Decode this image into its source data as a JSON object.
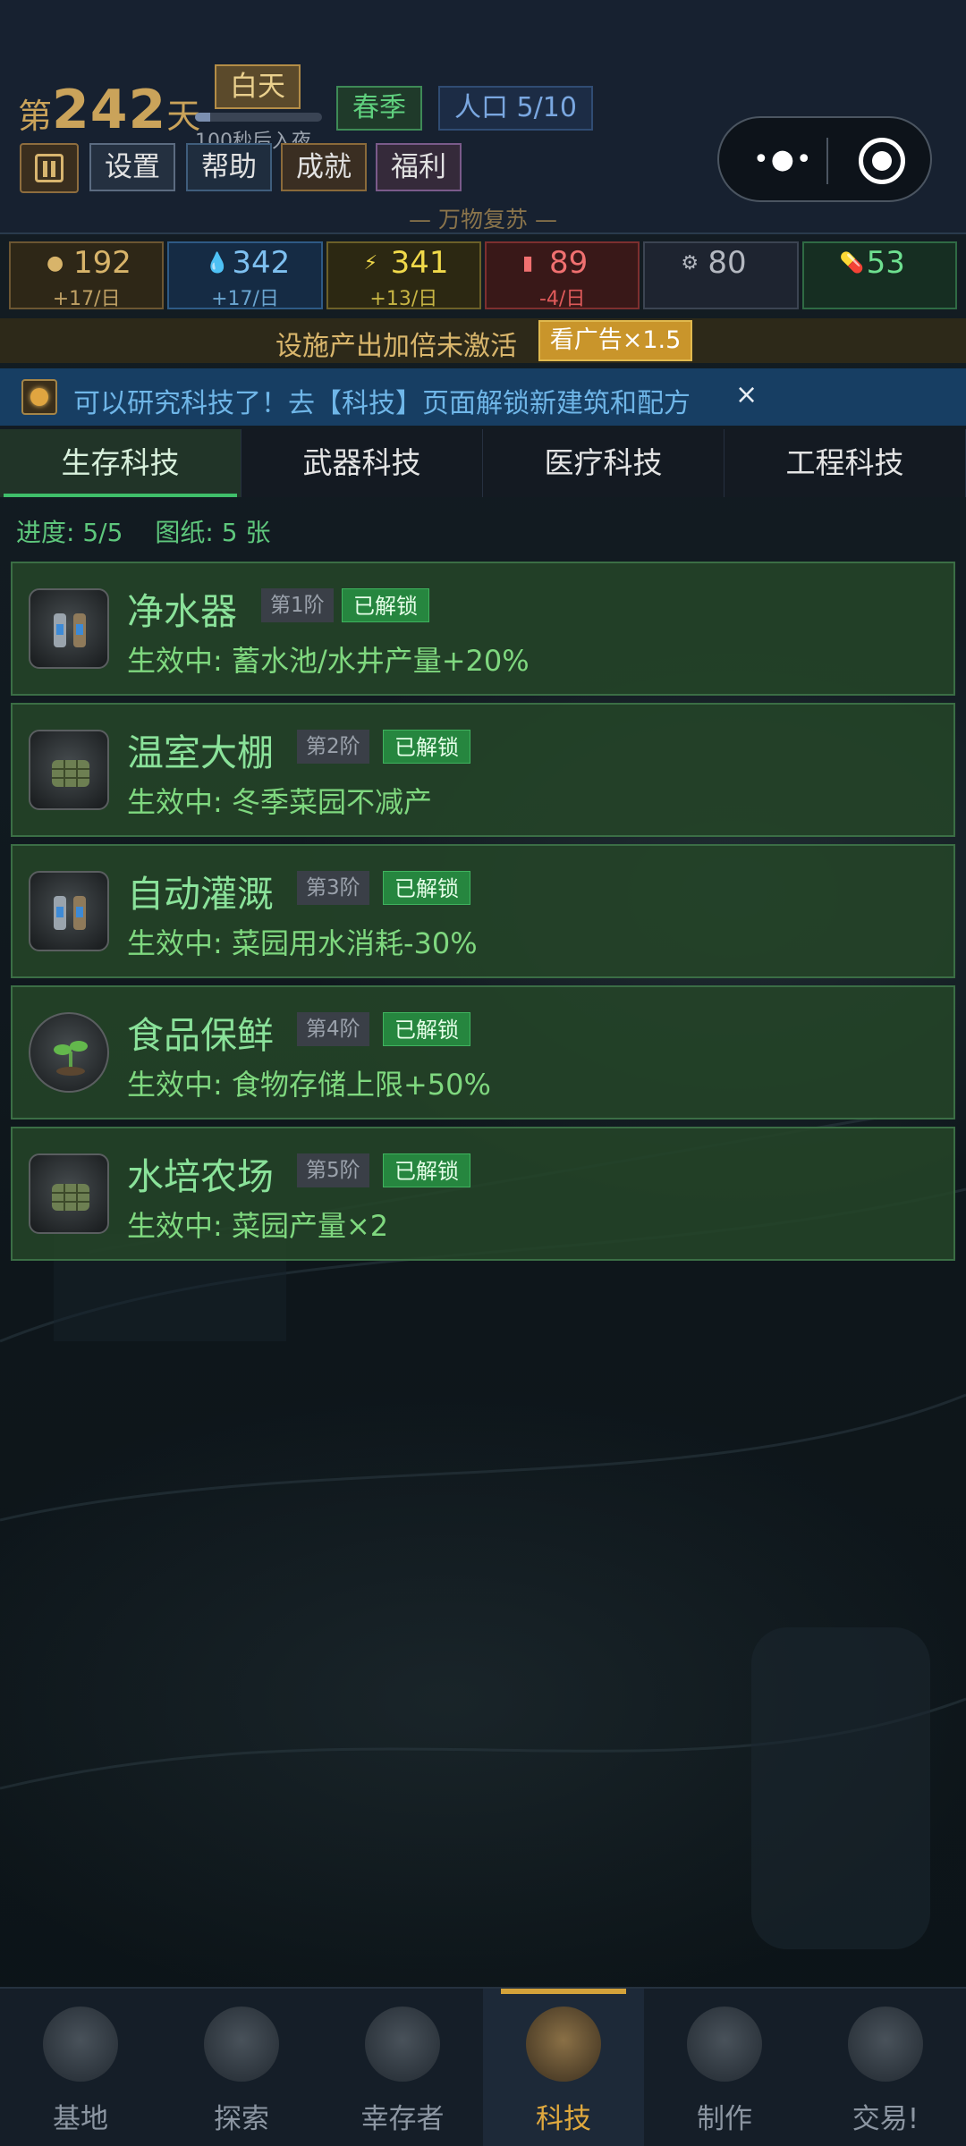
{
  "header": {
    "day_prefix": "第",
    "day_number": "242",
    "day_suffix": "天",
    "day_state": "白天",
    "day_progress": 0.12,
    "day_hint": "100秒后入夜",
    "season": "春季",
    "population": "人口 5/10",
    "buttons": {
      "settings": "设置",
      "help": "帮助",
      "achievements": "成就",
      "welfare": "福利"
    },
    "tagline": "— 万物复苏 —"
  },
  "resources": [
    {
      "icon": "food-icon",
      "glyph": "●",
      "value": "192",
      "rate": "+17/日",
      "color": "#d8b46a"
    },
    {
      "icon": "water-drop-icon",
      "glyph": "💧",
      "value": "342",
      "rate": "+17/日",
      "color": "#7ec0f0"
    },
    {
      "icon": "energy-icon",
      "glyph": "⚡",
      "value": "341",
      "rate": "+13/日",
      "color": "#f0d94a"
    },
    {
      "icon": "fuel-canister-icon",
      "glyph": "▮",
      "value": "89",
      "rate": "-4/日",
      "color": "#f07070"
    },
    {
      "icon": "gear-icon",
      "glyph": "⚙",
      "value": "80",
      "rate": "",
      "color": "#b4b8c0"
    },
    {
      "icon": "medicine-icon",
      "glyph": "💊",
      "value": "53",
      "rate": "",
      "color": "#6ee090"
    }
  ],
  "boost": {
    "text": "设施产出加倍未激活",
    "button": "看广告×1.5"
  },
  "notice": {
    "text": "可以研究科技了！去【科技】页面解锁新建筑和配方",
    "close": "×"
  },
  "tabs": [
    "生存科技",
    "武器科技",
    "医疗科技",
    "工程科技"
  ],
  "progress": {
    "progress_text": "进度: 5/5",
    "blueprints_text": "图纸: 5 张"
  },
  "techs": [
    {
      "name": "净水器",
      "tier": "第1阶",
      "status": "已解锁",
      "effect": "生效中: 蓄水池/水井产量+20%",
      "icon": "water-purifier-icon"
    },
    {
      "name": "温室大棚",
      "tier": "第2阶",
      "status": "已解锁",
      "effect": "生效中: 冬季菜园不减产",
      "icon": "greenhouse-icon"
    },
    {
      "name": "自动灌溉",
      "tier": "第3阶",
      "status": "已解锁",
      "effect": "生效中: 菜园用水消耗-30%",
      "icon": "irrigation-icon"
    },
    {
      "name": "食品保鲜",
      "tier": "第4阶",
      "status": "已解锁",
      "effect": "生效中: 食物存储上限+50%",
      "icon": "seedling-icon"
    },
    {
      "name": "水培农场",
      "tier": "第5阶",
      "status": "已解锁",
      "effect": "生效中: 菜园产量×2",
      "icon": "hydroponic-crate-icon"
    }
  ],
  "nav": [
    "基地",
    "探索",
    "幸存者",
    "科技",
    "制作",
    "交易!"
  ],
  "nav_active": "科技"
}
